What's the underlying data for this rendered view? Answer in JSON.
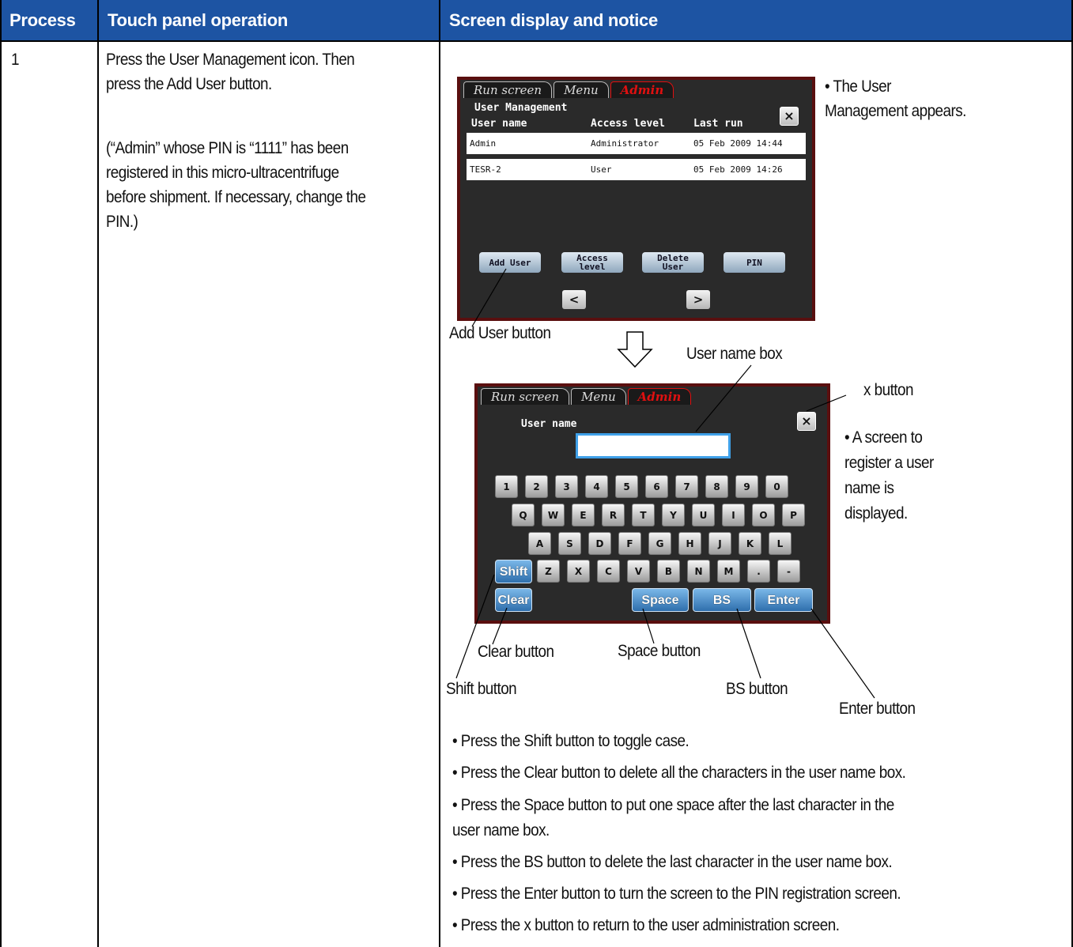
{
  "header": {
    "col1": "Process",
    "col2": "Touch panel operation",
    "col3": "Screen display and notice"
  },
  "row": {
    "process": "1",
    "operation_line1": "Press the User Management icon. Then",
    "operation_line2": "press the Add User button.",
    "note_line1": "(“Admin” whose PIN is “1111” has been",
    "note_line2": "registered in this micro-ultracentrifuge",
    "note_line3": "before shipment. If necessary, change the",
    "note_line4": "PIN.)"
  },
  "screen1": {
    "tabs": [
      "Run screen",
      "Menu",
      "Admin"
    ],
    "title": "User Management",
    "col_user": "User name",
    "col_access": "Access level",
    "col_last": "Last run",
    "close": "×",
    "users": [
      {
        "name": "Admin",
        "access": "Administrator",
        "last": "05 Feb 2009 14:44"
      },
      {
        "name": "TESR-2",
        "access": "User",
        "last": "05 Feb 2009 14:26"
      }
    ],
    "btn_add": "Add User",
    "btn_access_1": "Access",
    "btn_access_2": "level",
    "btn_delete_1": "Delete",
    "btn_delete_2": "User",
    "btn_pin": "PIN",
    "prev": "<",
    "next": ">",
    "notice_1": "• The User",
    "notice_2": "Management appears."
  },
  "screen2": {
    "tabs": [
      "Run screen",
      "Menu",
      "Admin"
    ],
    "label": "User name",
    "close": "×",
    "row1": [
      "1",
      "2",
      "3",
      "4",
      "5",
      "6",
      "7",
      "8",
      "9",
      "0"
    ],
    "row2": [
      "Q",
      "W",
      "E",
      "R",
      "T",
      "Y",
      "U",
      "I",
      "O",
      "P"
    ],
    "row3": [
      "A",
      "S",
      "D",
      "F",
      "G",
      "H",
      "J",
      "K",
      "L"
    ],
    "row4": [
      "Z",
      "X",
      "C",
      "V",
      "B",
      "N",
      "M",
      ".",
      "-"
    ],
    "shift": "Shift",
    "clear": "Clear",
    "space": "Space",
    "bs": "BS",
    "enter": "Enter",
    "notice_1": "• A screen to",
    "notice_2": "register a user",
    "notice_3": "name is",
    "notice_4": "displayed."
  },
  "callouts": {
    "add_user": "Add User button",
    "user_name_box": "User name box",
    "x_button": "x button",
    "clear_button": "Clear button",
    "space_button": "Space button",
    "shift_button": "Shift button",
    "bs_button": "BS button",
    "enter_button": "Enter button"
  },
  "notes": [
    "• Press the Shift button to toggle case.",
    "• Press the Clear button to delete all the characters in the user name box.",
    "• Press the Space button to put one space after the last character in the",
    "user name box.",
    "• Press the BS button to delete the last character in the user name box.",
    "• Press the Enter button to turn the screen to the PIN registration screen.",
    "• Press the x button to return to the user administration screen."
  ]
}
